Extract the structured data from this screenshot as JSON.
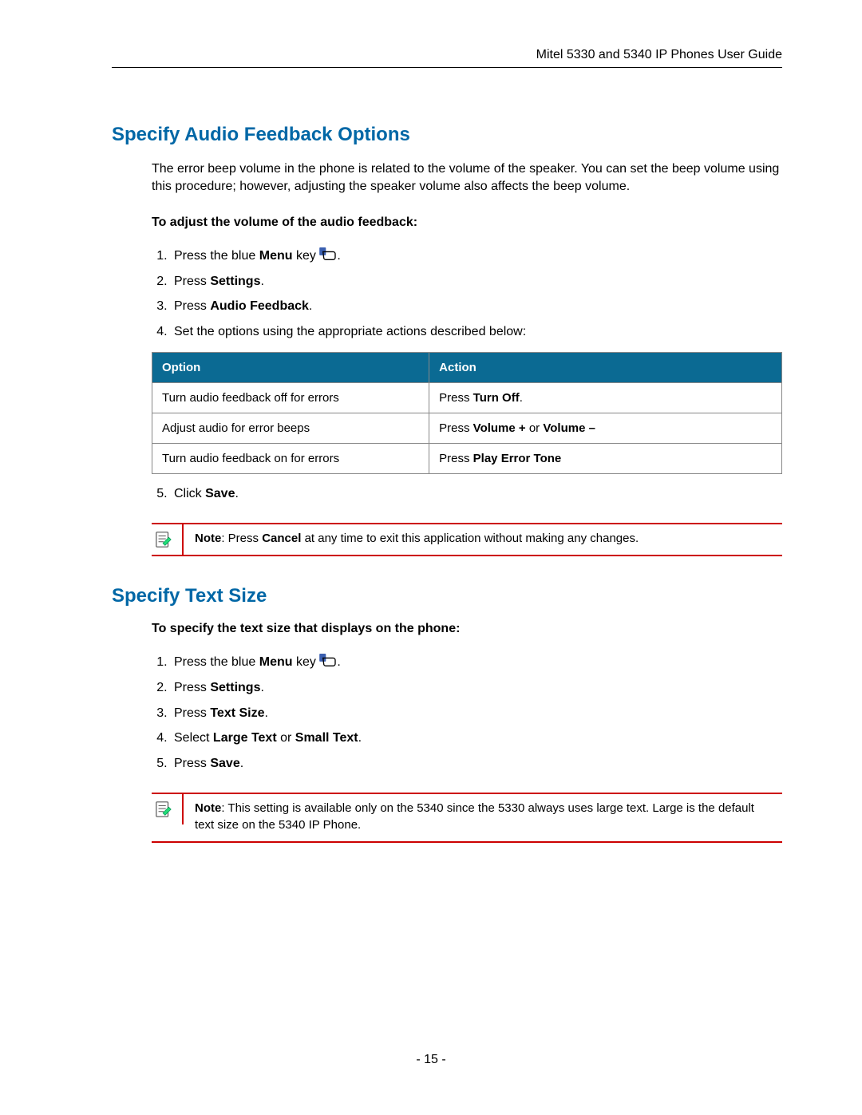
{
  "header": {
    "title": "Mitel 5330 and 5340 IP Phones User Guide"
  },
  "section1": {
    "title": "Specify Audio Feedback Options",
    "intro": "The error beep volume in the phone is related to the volume of the speaker. You can set the beep volume using this procedure; however, adjusting the speaker volume also affects the beep volume.",
    "subhead": "To adjust the volume of the audio feedback:",
    "steps": {
      "s1_pre": "Press the blue ",
      "s1_bold": "Menu",
      "s1_post": " key ",
      "s1_end": ".",
      "s2_pre": "Press ",
      "s2_bold": "Settings",
      "s2_end": ".",
      "s3_pre": "Press ",
      "s3_bold": "Audio Feedback",
      "s3_end": ".",
      "s4": "Set the options using the appropriate actions described below:",
      "s5_pre": "Click ",
      "s5_bold": "Save",
      "s5_end": "."
    },
    "table": {
      "col1": "Option",
      "col2": "Action",
      "rows": [
        {
          "opt": "Turn audio feedback off for errors",
          "act_pre": "Press ",
          "act_bold": "Turn Off",
          "act_end": "."
        },
        {
          "opt": "Adjust audio for error beeps",
          "act_pre": "Press ",
          "act_bold": "Volume +",
          "act_mid": " or ",
          "act_bold2": "Volume –",
          "act_end": ""
        },
        {
          "opt": "Turn audio feedback on for errors",
          "act_pre": "Press ",
          "act_bold": "Play Error Tone",
          "act_end": ""
        }
      ]
    },
    "note": {
      "label": "Note",
      "sep": ": Press ",
      "bold": "Cancel",
      "rest": " at any time to exit this application without making any changes."
    }
  },
  "section2": {
    "title": "Specify Text Size",
    "subhead": "To specify the text size that displays on the phone:",
    "steps": {
      "s1_pre": "Press the blue ",
      "s1_bold": "Menu",
      "s1_post": " key ",
      "s1_end": ".",
      "s2_pre": "Press ",
      "s2_bold": "Settings",
      "s2_end": ".",
      "s3_pre": "Press ",
      "s3_bold": "Text Size",
      "s3_end": ".",
      "s4_pre": "Select ",
      "s4_bold": "Large Text",
      "s4_mid": " or ",
      "s4_bold2": "Small Text",
      "s4_end": ".",
      "s5_pre": "Press ",
      "s5_bold": "Save",
      "s5_end": "."
    },
    "note": {
      "label": "Note",
      "rest": ": This setting is available only on the 5340 since the 5330 always uses large text. Large is the default text size on the 5340 IP Phone."
    }
  },
  "page_number": "- 15 -"
}
